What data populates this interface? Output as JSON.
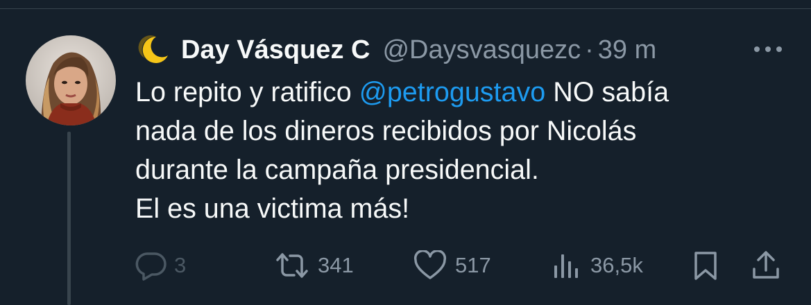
{
  "tweet": {
    "author": {
      "display_name": "Day Vásquez C",
      "handle": "@Daysvasquezc",
      "emoji": "crescent-moon-icon"
    },
    "separator": "·",
    "time": "39 m",
    "text": {
      "line1_before": "Lo repito y ratifico ",
      "mention": "@petrogustavo",
      "line1_after": " NO sabía",
      "line2": "nada de los dineros recibidos por Nicolás",
      "line3": "durante la campaña presidencial.",
      "line4": "El es una victima más!"
    },
    "actions": {
      "replies": "3",
      "retweets": "341",
      "likes": "517",
      "views": "36,5k"
    }
  },
  "colors": {
    "background": "#15202b",
    "text": "#f7f9f9",
    "secondary": "#8b98a5",
    "link": "#1d9bf0",
    "divider": "#38444d"
  }
}
